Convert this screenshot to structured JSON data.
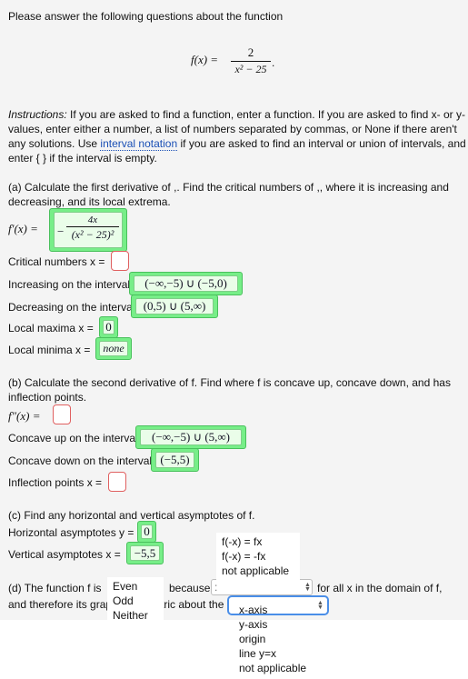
{
  "intro": "Please answer the following questions about the function",
  "function": {
    "lhs": "f(x) =",
    "numerator": "2",
    "denominator": "x² − 25",
    "period": "."
  },
  "instructions": {
    "label": "Instructions:",
    "line1": "If you are asked to find a function, enter a function. If you are asked to find x- or y-",
    "line2": "values, enter either a number, a list of numbers separated by commas, or None if there aren't",
    "line3_pre": "any solutions. Use",
    "line3_link": "interval notation",
    "line3_post": "if you are asked to find an interval or union of intervals, and",
    "line4": "enter { } if the interval is empty."
  },
  "part_a": {
    "line1": "(a) Calculate the first derivative of ,. Find the critical numbers of ,, where it is increasing and",
    "line2": "decreasing, and its local extrema.",
    "fprime_label": "f′(x) =",
    "fprime_sign": "−",
    "fprime_num": "4x",
    "fprime_den": "(x² − 25)²",
    "critical_label": "Critical numbers x =",
    "critical_value": "",
    "increasing_label": "Increasing on the interval",
    "increasing_value": "(−∞,−5) ∪ (−5,0)",
    "decreasing_label": "Decreasing on the interval",
    "decreasing_value": "(0,5) ∪ (5,∞)",
    "maxima_label": "Local maxima x =",
    "maxima_value": "0",
    "minima_label": "Local minima x =",
    "minima_value": "none"
  },
  "part_b": {
    "line1": "(b) Calculate the second derivative of f. Find where f is concave up, concave down, and has",
    "line2": "inflection points.",
    "fdouble_label": "f″(x) =",
    "fdouble_value": "",
    "concave_up_label": "Concave up on the interval",
    "concave_up_value": "(−∞,−5) ∪ (5,∞)",
    "concave_down_label": "Concave down on the interval",
    "concave_down_value": "(−5,5)",
    "inflection_label": "Inflection points x =",
    "inflection_value": ""
  },
  "part_c": {
    "line1": "(c) Find any horizontal and vertical asymptotes of f.",
    "horizontal_label": "Horizontal asymptotes y =",
    "horizontal_value": "0",
    "vertical_label": "Vertical asymptotes x =",
    "vertical_value": "−5,5"
  },
  "part_d": {
    "line1_pre": "(d) The function f is",
    "because": "because",
    "because_partial": ":",
    "line1_post": "for all x in the domain of f,",
    "line2_pre": "and therefore its grap",
    "line2_mid": "tric about the",
    "parity_options": [
      "Even",
      "Odd",
      "Neither"
    ],
    "because_options": [
      "f(-x) = fx",
      "f(-x) = -fx",
      "not applicable"
    ],
    "symmetry_options": [
      "x-axis",
      "y-axis",
      "origin",
      "line y=x",
      "not applicable"
    ]
  }
}
